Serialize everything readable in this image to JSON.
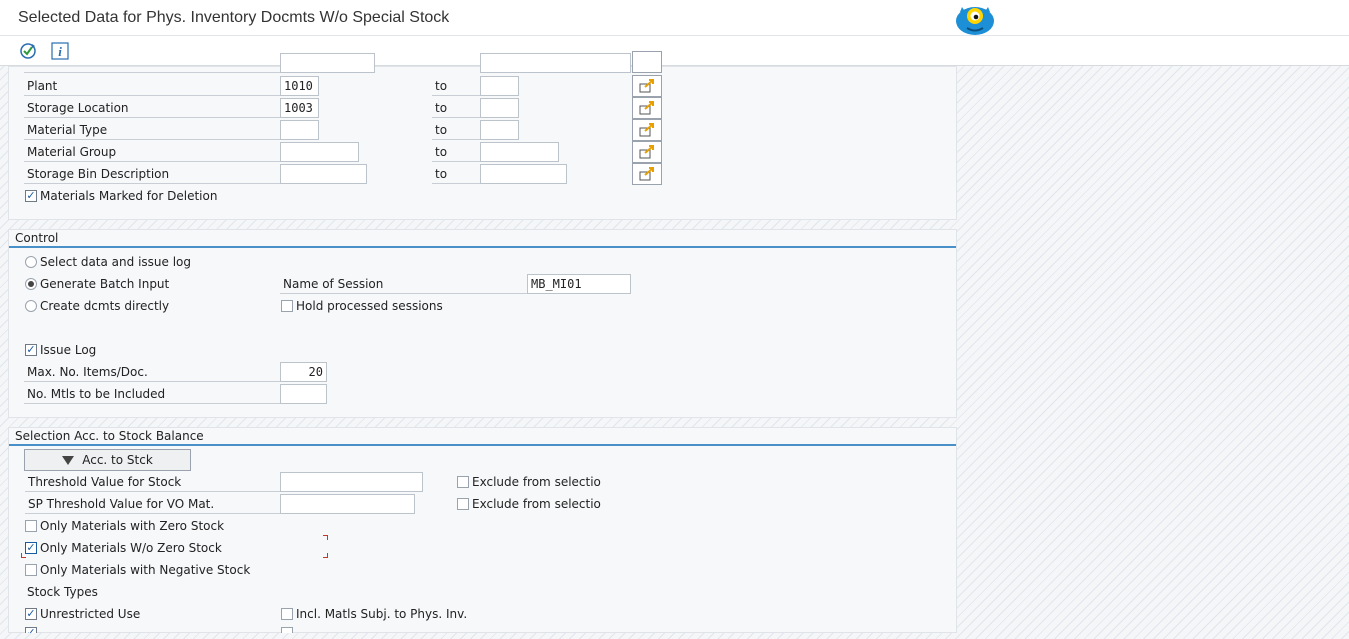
{
  "window": {
    "title": "Selected Data for Phys. Inventory Docmts W/o Special Stock"
  },
  "toolbar": {
    "execute_icon": "execute-icon",
    "info_icon": "info-icon"
  },
  "selection": {
    "to_label": "to",
    "rows": [
      {
        "label": "Plant",
        "low": "1010",
        "high": ""
      },
      {
        "label": "Storage Location",
        "low": "1003",
        "high": ""
      },
      {
        "label": "Material Type",
        "low": "",
        "high": ""
      },
      {
        "label": "Material Group",
        "low": "",
        "high": ""
      },
      {
        "label": "Storage Bin Description",
        "low": "",
        "high": ""
      }
    ],
    "deleted_flag": {
      "label": "Materials Marked for Deletion",
      "checked": true
    }
  },
  "control": {
    "title": "Control",
    "radio_select": {
      "label": "Select data and issue log",
      "selected": false
    },
    "radio_batch": {
      "label": "Generate Batch Input",
      "selected": true
    },
    "radio_direct": {
      "label": "Create dcmts directly",
      "selected": false
    },
    "session_label": "Name of Session",
    "session_value": "MB_MI01",
    "hold_label": "Hold processed sessions",
    "issue_log_label": "Issue Log",
    "max_items_label": "Max. No. Items/Doc.",
    "max_items_value": "20",
    "no_mtls_label": "No. Mtls to be Included",
    "no_mtls_value": ""
  },
  "stock_balance": {
    "title": "Selection Acc. to Stock Balance",
    "acc_button": "Acc. to Stck",
    "threshold_label": "Threshold Value for Stock",
    "sp_threshold_label": "SP Threshold Value for VO Mat.",
    "exclude_label_1": "Exclude from selectio",
    "exclude_label_2": "Exclude from selectio",
    "zero_stock_label": "Only Materials with Zero Stock",
    "wo_zero_label": "Only Materials W/o Zero Stock",
    "negative_label": "Only Materials with Negative Stock",
    "stock_types_label": "Stock Types",
    "unrestricted_label": "Unrestricted Use",
    "incl_matls_label": "Incl. Matls Subj. to Phys. Inv."
  }
}
